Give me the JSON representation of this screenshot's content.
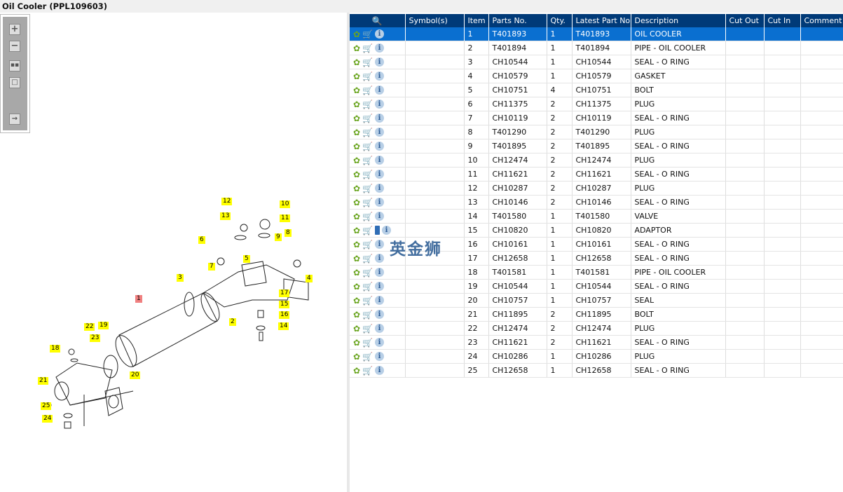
{
  "title": "Oil Cooler (PPL109603)",
  "columns": [
    "Symbol(s)",
    "Item",
    "Parts No.",
    "Qty.",
    "Latest Part No.",
    "Description",
    "Cut Out",
    "Cut In",
    "Comment"
  ],
  "rows": [
    [
      "1",
      "T401893",
      "1",
      "T401893",
      "OIL COOLER"
    ],
    [
      "2",
      "T401894",
      "1",
      "T401894",
      "PIPE - OIL COOLER"
    ],
    [
      "3",
      "CH10544",
      "1",
      "CH10544",
      "SEAL - O RING"
    ],
    [
      "4",
      "CH10579",
      "1",
      "CH10579",
      "GASKET"
    ],
    [
      "5",
      "CH10751",
      "4",
      "CH10751",
      "BOLT"
    ],
    [
      "6",
      "CH11375",
      "2",
      "CH11375",
      "PLUG"
    ],
    [
      "7",
      "CH10119",
      "2",
      "CH10119",
      "SEAL - O RING"
    ],
    [
      "8",
      "T401290",
      "2",
      "T401290",
      "PLUG"
    ],
    [
      "9",
      "T401895",
      "2",
      "T401895",
      "SEAL - O RING"
    ],
    [
      "10",
      "CH12474",
      "2",
      "CH12474",
      "PLUG"
    ],
    [
      "11",
      "CH11621",
      "2",
      "CH11621",
      "SEAL - O RING"
    ],
    [
      "12",
      "CH10287",
      "2",
      "CH10287",
      "PLUG"
    ],
    [
      "13",
      "CH10146",
      "2",
      "CH10146",
      "SEAL - O RING"
    ],
    [
      "14",
      "T401580",
      "1",
      "T401580",
      "VALVE"
    ],
    [
      "15",
      "CH10820",
      "1",
      "CH10820",
      "ADAPTOR"
    ],
    [
      "16",
      "CH10161",
      "1",
      "CH10161",
      "SEAL - O RING"
    ],
    [
      "17",
      "CH12658",
      "1",
      "CH12658",
      "SEAL - O RING"
    ],
    [
      "18",
      "T401581",
      "1",
      "T401581",
      "PIPE - OIL COOLER"
    ],
    [
      "19",
      "CH10544",
      "1",
      "CH10544",
      "SEAL - O RING"
    ],
    [
      "20",
      "CH10757",
      "1",
      "CH10757",
      "SEAL"
    ],
    [
      "21",
      "CH11895",
      "2",
      "CH11895",
      "BOLT"
    ],
    [
      "22",
      "CH12474",
      "2",
      "CH12474",
      "PLUG"
    ],
    [
      "23",
      "CH11621",
      "2",
      "CH11621",
      "SEAL - O RING"
    ],
    [
      "24",
      "CH10286",
      "1",
      "CH10286",
      "PLUG"
    ],
    [
      "25",
      "CH12658",
      "1",
      "CH12658",
      "SEAL - O RING"
    ]
  ],
  "watermark": "英金狮",
  "callouts": [
    "12",
    "13",
    "10",
    "11",
    "6",
    "7",
    "5",
    "9",
    "8",
    "4",
    "3",
    "1",
    "17",
    "15",
    "16",
    "14",
    "2",
    "22",
    "19",
    "23",
    "18",
    "21",
    "20",
    "25",
    "24"
  ],
  "colors": {
    "header": "#003a78",
    "selected": "#0a6fd0",
    "callout": "#ffff00",
    "callout_selected": "#f08080"
  }
}
